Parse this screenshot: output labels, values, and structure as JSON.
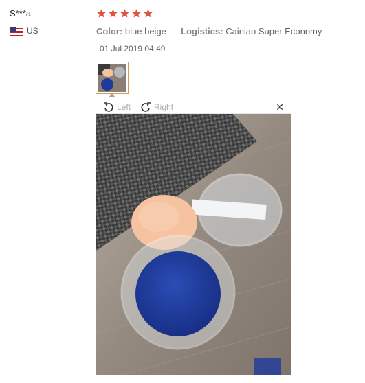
{
  "reviewer": {
    "name": "S***a",
    "country": "US"
  },
  "rating": {
    "stars": 5,
    "max": 5,
    "color": "#e0533f"
  },
  "details": {
    "color_label": "Color:",
    "color_value": "blue beige",
    "logistics_label": "Logistics:",
    "logistics_value": "Cainiao Super Economy"
  },
  "date": "01 Jul 2019 04:49",
  "viewer": {
    "rotate_left_label": "Left",
    "rotate_right_label": "Right",
    "close_symbol": "✕"
  },
  "colors": {
    "thumb_border": "#d49a5a",
    "puff_beige": "#f6c2a0",
    "puff_blue": "#1e3a9c"
  }
}
